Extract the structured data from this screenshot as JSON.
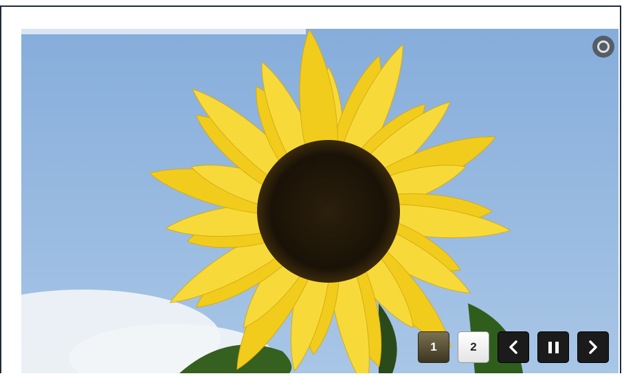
{
  "slider": {
    "progress": 0.476,
    "colors": {
      "sky": "#8eb4dd",
      "petal": "#f4d123",
      "center": "#1e1508",
      "leaf": "#2d5a1b",
      "active_page": "#5a5236"
    },
    "pagination": [
      {
        "label": "1",
        "active": true
      },
      {
        "label": "2",
        "active": false
      }
    ],
    "controls": {
      "prev_icon": "chevron-left-icon",
      "pause_icon": "pause-icon",
      "next_icon": "chevron-right-icon",
      "settings_icon": "settings-ring-icon"
    }
  }
}
